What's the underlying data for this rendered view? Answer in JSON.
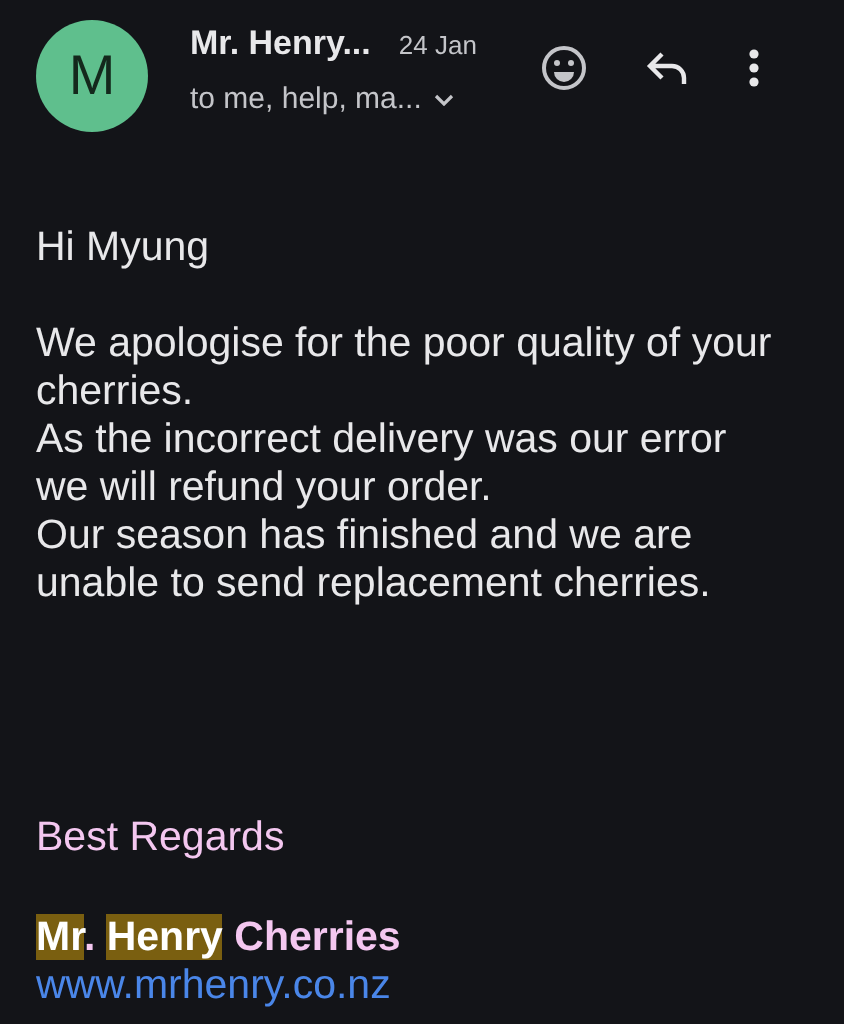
{
  "header": {
    "avatar_letter": "M",
    "sender": "Mr. Henry...",
    "date": "24 Jan",
    "recipients": "to me, help, ma..."
  },
  "body": {
    "greeting": "Hi Myung",
    "paragraphs": [
      "We apologise for the poor quality of your cherries.",
      "As the incorrect delivery was our error we will refund your order.",
      "Our season has finished and we are unable to send replacement cherries."
    ]
  },
  "signature": {
    "closing": "Best Regards",
    "name_parts": [
      {
        "text": "Mr",
        "highlighted": true
      },
      {
        "text": ". ",
        "highlighted": false
      },
      {
        "text": "Henry",
        "highlighted": true
      },
      {
        "text": " Cherries",
        "highlighted": false
      }
    ],
    "link": "www.mrhenry.co.nz"
  }
}
